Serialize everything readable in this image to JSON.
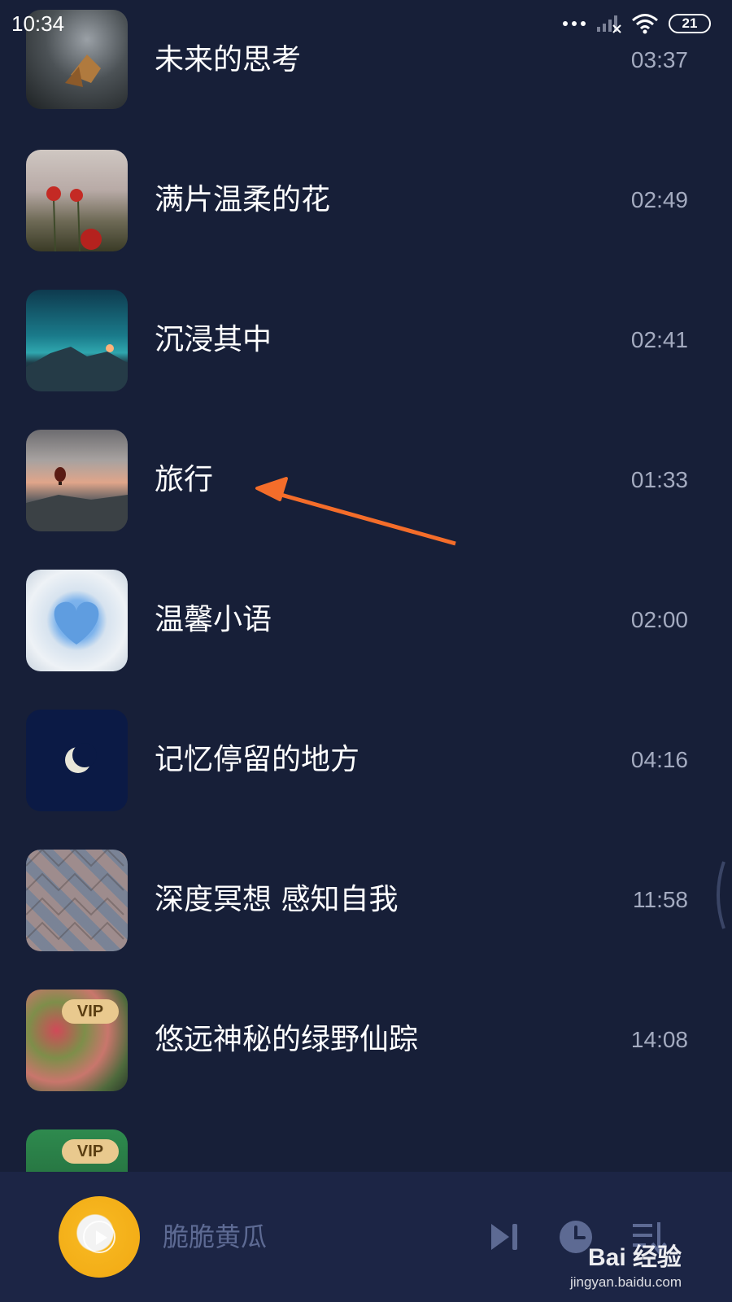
{
  "status_bar": {
    "time": "10:34",
    "battery": "21",
    "icons": [
      "more-dots-icon",
      "signal-icon",
      "wifi-icon",
      "battery-icon"
    ]
  },
  "tracks": [
    {
      "title": "未来的思考",
      "duration": "03:37",
      "thumb": "leaf",
      "vip": ""
    },
    {
      "title": "满片温柔的花",
      "duration": "02:49",
      "thumb": "flower",
      "vip": ""
    },
    {
      "title": "沉浸其中",
      "duration": "02:41",
      "thumb": "mountain",
      "vip": ""
    },
    {
      "title": "旅行",
      "duration": "01:33",
      "thumb": "balloon",
      "vip": ""
    },
    {
      "title": "温馨小语",
      "duration": "02:00",
      "thumb": "cloud",
      "vip": ""
    },
    {
      "title": "记忆停留的地方",
      "duration": "04:16",
      "thumb": "moon",
      "vip": ""
    },
    {
      "title": "深度冥想 感知自我",
      "duration": "11:58",
      "thumb": "tiles",
      "vip": ""
    },
    {
      "title": "悠远神秘的绿野仙踪",
      "duration": "14:08",
      "thumb": "forest",
      "vip": "VIP"
    },
    {
      "title": "",
      "duration": "",
      "thumb": "green",
      "vip": "VIP"
    }
  ],
  "player": {
    "title": "脆脆黄瓜",
    "icons": [
      "play-icon",
      "next-track-icon",
      "timer-clock-icon",
      "playlist-icon"
    ]
  },
  "watermark": {
    "main": "Bai 经验",
    "sub": "jingyan.baidu.com"
  },
  "colors": {
    "background": "#171f38",
    "player_bar": "#1c2545",
    "accent_arrow": "#f46d2a",
    "vip_badge": "#e9c98e",
    "duration_text": "#a4abc0",
    "player_icons": "#5d6a93"
  }
}
